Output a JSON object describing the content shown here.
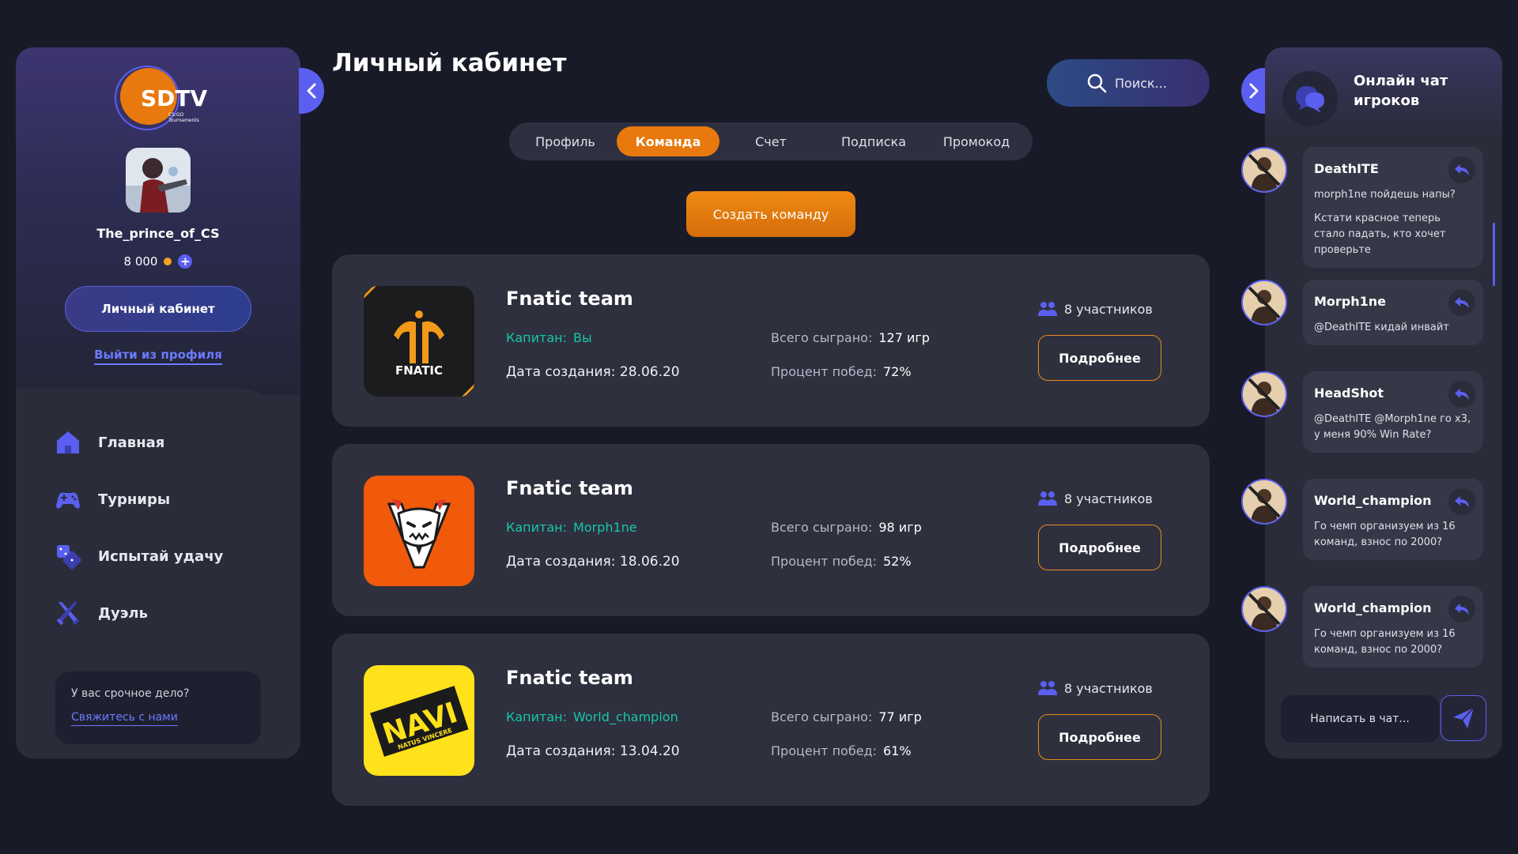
{
  "brand": {
    "logo_text": "SDTV",
    "logo_sub1": "CS:GO",
    "logo_sub2": "Tournaments"
  },
  "user": {
    "name": "The_prince_of_CS",
    "balance": "8 000"
  },
  "sidebar": {
    "cabinet_button": "Личный кабинет",
    "logout": "Выйти из профиля",
    "menu": [
      {
        "label": "Главная",
        "icon": "home-icon"
      },
      {
        "label": "Турниры",
        "icon": "gamepad-icon"
      },
      {
        "label": "Испытай удачу",
        "icon": "dice-icon"
      },
      {
        "label": "Дуэль",
        "icon": "swords-icon"
      }
    ],
    "help": {
      "text": "У вас срочное дело?",
      "link": "Свяжитесь с нами"
    }
  },
  "main": {
    "title": "Личный кабинет",
    "search_placeholder": "Поиск...",
    "tabs": [
      "Профиль",
      "Команда",
      "Счет",
      "Подписка",
      "Промокод"
    ],
    "active_tab": "Команда",
    "create_button": "Создать команду",
    "teams": [
      {
        "name": "Fnatic team",
        "captain_label": "Капитан:",
        "captain": "Вы",
        "created_label": "Дата создания:",
        "created": "28.06.20",
        "played_label": "Всего сыграно:",
        "played": "127 игр",
        "winrate_label": "Процент побед:",
        "winrate": "72%",
        "members": "8 участников",
        "details": "Подробнее",
        "logo": "fnatic",
        "logo_text": "FNATIC"
      },
      {
        "name": "Fnatic team",
        "captain_label": "Капитан:",
        "captain": "Morph1ne",
        "created_label": "Дата создания:",
        "created": "18.06.20",
        "played_label": "Всего сыграно:",
        "played": "98 игр",
        "winrate_label": "Процент побед:",
        "winrate": "52%",
        "members": "8 участников",
        "details": "Подробнее",
        "logo": "virtus-pro"
      },
      {
        "name": "Fnatic team",
        "captain_label": "Капитан:",
        "captain": "World_champion",
        "created_label": "Дата создания:",
        "created": "13.04.20",
        "played_label": "Всего сыграно:",
        "played": "77 игр",
        "winrate_label": "Процент побед:",
        "winrate": "61%",
        "members": "8 участников",
        "details": "Подробнее",
        "logo": "navi",
        "logo_text": "NAVI",
        "logo_sub": "NATUS VINCERE"
      }
    ]
  },
  "chat": {
    "title": "Онлайн чат игроков",
    "messages": [
      {
        "author": "DeathITE",
        "lines": [
          "morph1ne пойдешь напы?",
          "Кстати красное теперь стало падать, кто хочет проверьте"
        ]
      },
      {
        "author": "Morph1ne",
        "lines": [
          "@DeathITE кидай инвайт"
        ]
      },
      {
        "author": "HeadShot",
        "lines": [
          "@DeathITE @Morph1ne го х3, у меня 90% Win Rate?"
        ]
      },
      {
        "author": "World_champion",
        "lines": [
          "Го чемп организуем из 16 команд, взнос по 2000?"
        ]
      },
      {
        "author": "World_champion",
        "lines": [
          "Го чемп организуем из 16 команд, взнос по 2000?"
        ]
      }
    ],
    "input_placeholder": "Написать в чат..."
  },
  "colors": {
    "accent_orange": "#e8790e",
    "accent_blue": "#5b5ff0",
    "captain_green": "#18c7a8",
    "bg": "#181a27",
    "card": "#2e303e"
  }
}
